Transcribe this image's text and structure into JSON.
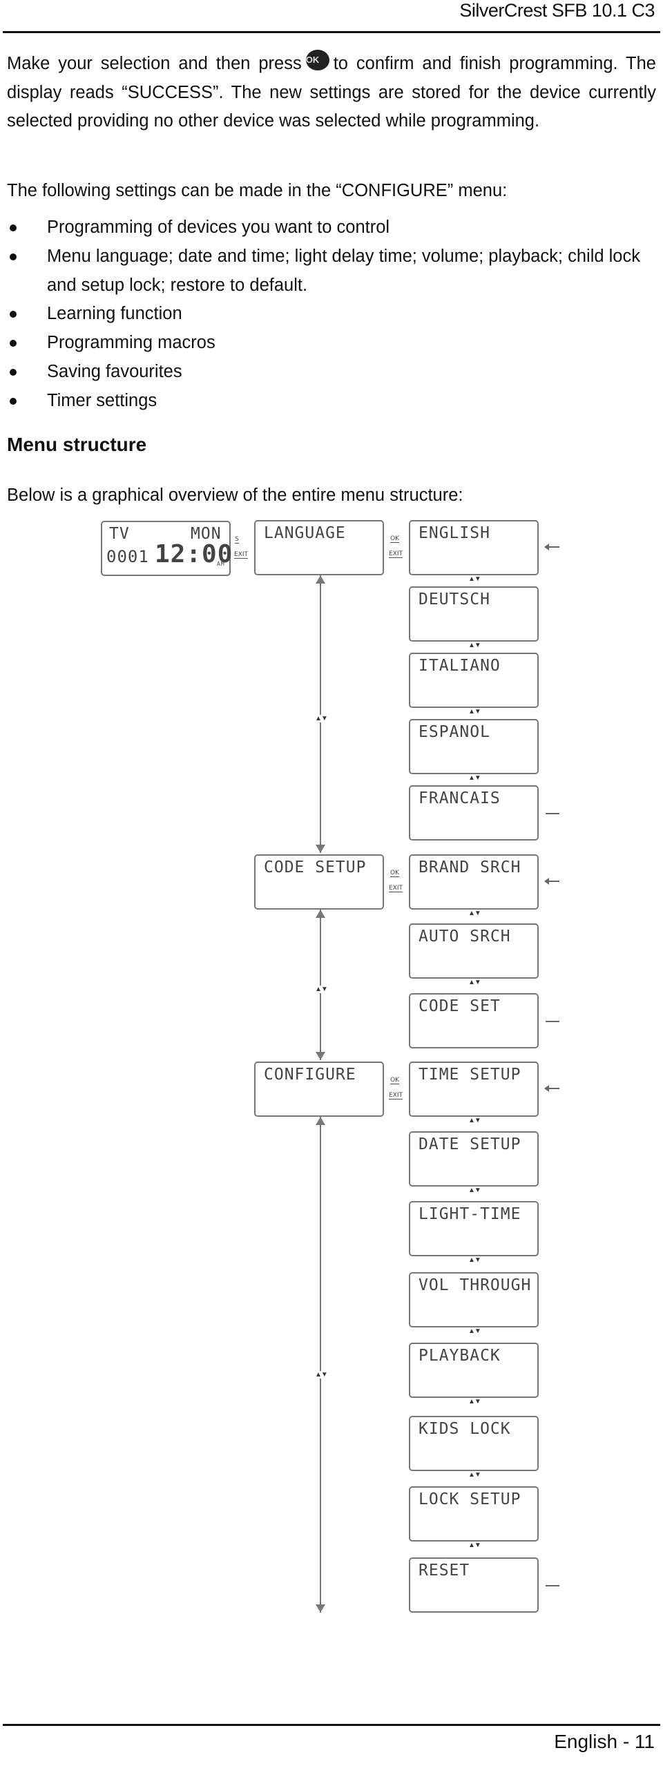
{
  "header": {
    "title": "SilverCrest SFB 10.1 C3"
  },
  "intro": {
    "before_icon": "Make your selection and then press",
    "ok_icon": "OK",
    "after_icon": "to confirm and finish programming. The display reads “SUCCESS”. The new settings are stored for the device currently selected providing no other device was selected while programming."
  },
  "configure_intro": "The following settings can be made in the “CONFIGURE” menu:",
  "bullets": [
    "Programming of devices you want to control",
    "Menu language; date and time; light delay time; volume; playback; child lock and setup lock; restore to default.",
    "Learning function",
    "Programming macros",
    "Saving favourites",
    "Timer settings"
  ],
  "section": {
    "title": "Menu structure",
    "intro": "Below is a graphical overview of the entire menu structure:"
  },
  "diagram": {
    "start_display": {
      "device": "TV",
      "day": "MON",
      "code": "0001",
      "time": "12:00",
      "ampm": "AM"
    },
    "key_labels": {
      "setup": "S",
      "ok": "OK",
      "exit": "EXIT",
      "updown": "▲▼"
    },
    "main_menu": [
      "LANGUAGE",
      "CODE SETUP",
      "CONFIGURE"
    ],
    "language_options": [
      "ENGLISH",
      "DEUTSCH",
      "ITALIANO",
      "ESPANOL",
      "FRANCAIS"
    ],
    "code_setup_options": [
      "BRAND SRCH",
      "AUTO SRCH",
      "CODE SET"
    ],
    "configure_options": [
      "TIME SETUP",
      "DATE SETUP",
      "LIGHT-TIME",
      "VOL THROUGH",
      "PLAYBACK",
      "KIDS LOCK",
      "LOCK SETUP",
      "RESET"
    ]
  },
  "footer": {
    "page": "English - 11"
  }
}
